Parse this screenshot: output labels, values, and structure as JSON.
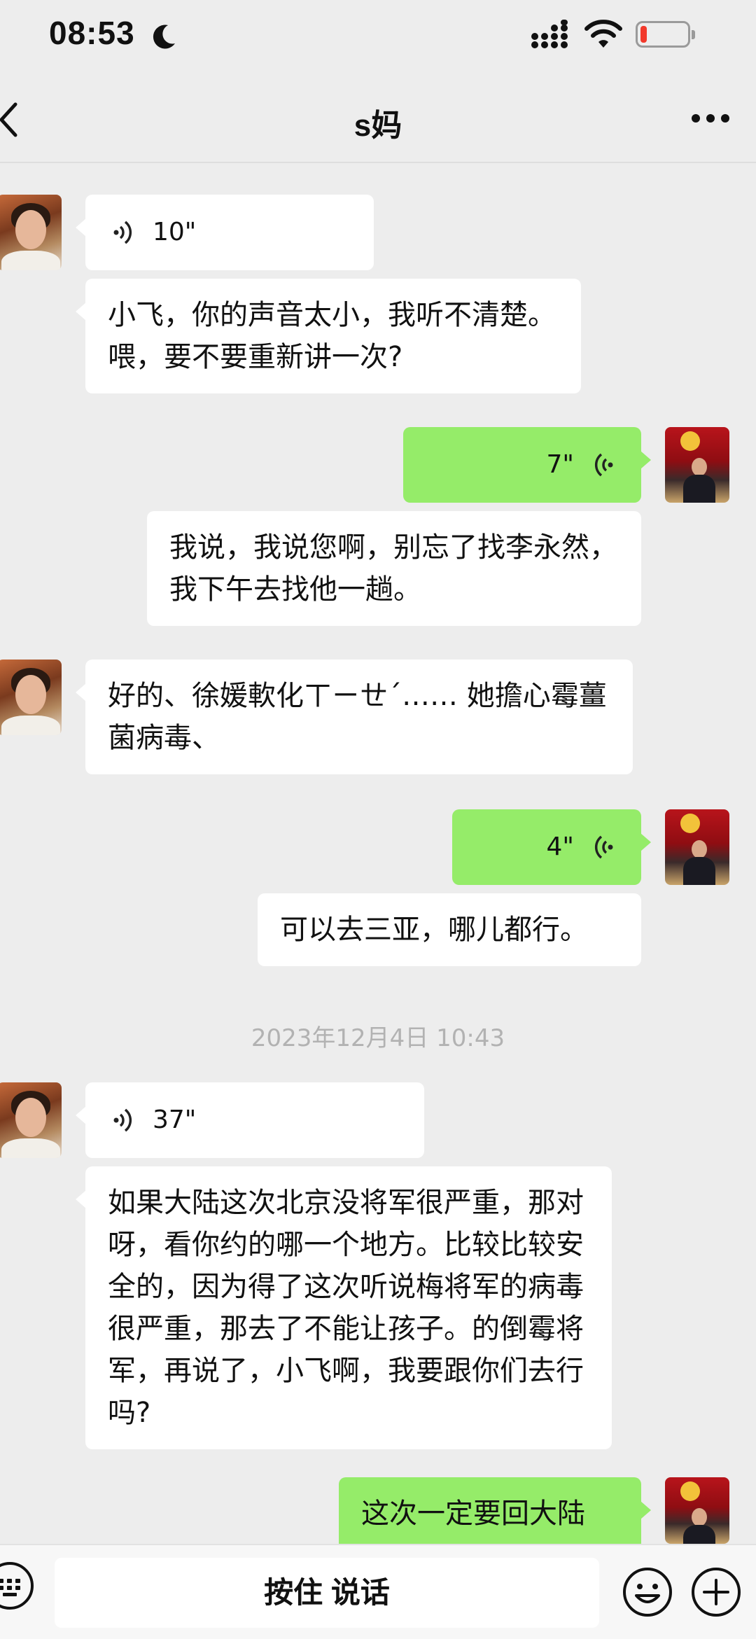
{
  "status_bar": {
    "time": "08:53"
  },
  "header": {
    "title": "s妈"
  },
  "messages": {
    "m1_voice_duration": "10\"",
    "m2_text": "小飞，你的声音太小，我听不清楚。喂，要不要重新讲一次?",
    "m3_voice_duration": "7\"",
    "m4_text": "我说，我说您啊，别忘了找李永然，我下午去找他一趟。",
    "m5_text": "好的、徐媛軟化ㄒㄧㄝˊ…… 她擔心霉薑菌病毒、",
    "m6_voice_duration": "4\"",
    "m7_text": "可以去三亚，哪儿都行。",
    "timestamp": "2023年12月4日 10:43",
    "m8_voice_duration": "37\"",
    "m9_text": "如果大陆这次北京没将军很严重，那对呀，看你约的哪一个地方。比较比较安全的，因为得了这次听说梅将军的病毒很严重，那去了不能让孩子。的倒霉将军，再说了，小飞啊，我要跟你们去行吗?",
    "m10_text": "这次一定要回大陆"
  },
  "input_bar": {
    "hold_to_talk_label": "按住 说话"
  },
  "colors": {
    "outgoing_bubble": "#95ec69",
    "incoming_bubble": "#ffffff",
    "background": "#ededed",
    "battery_low": "#f2392b"
  },
  "icons": [
    "moon-icon",
    "signal-icon",
    "wifi-icon",
    "battery-icon",
    "back-icon",
    "more-icon",
    "voice-wave-icon",
    "keyboard-icon",
    "emoji-icon",
    "plus-icon"
  ]
}
